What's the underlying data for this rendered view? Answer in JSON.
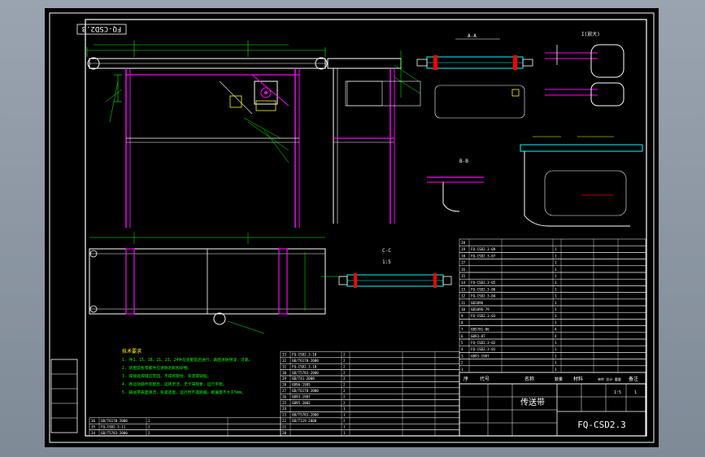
{
  "drawing": {
    "code": "FQ-CSD2.3",
    "code_stamp_top": "FQ-CSD2.3",
    "title": "传送带",
    "background": "#000000",
    "colors": {
      "frame": "#ffffff",
      "steel": "#ff00ff",
      "dimension": "#00ff00",
      "outline": "#ffffff",
      "yellow": "#ffff00",
      "cyan": "#00ffff",
      "red": "#ff0000"
    }
  },
  "section_labels": {
    "aa": "A-A",
    "bb": "B-B",
    "cc": "C-C",
    "scale": "1:5",
    "detail": "I(放大)"
  },
  "table_header": {
    "no": "序",
    "code": "代号",
    "name": "名称",
    "qty": "数量",
    "material": "材料",
    "weight": "单件 总计 重量",
    "note": "备注"
  },
  "bom_right": [
    {
      "no": "28",
      "code": "",
      "name": "",
      "qty": "",
      "mat": "",
      "note": ""
    },
    {
      "no": "19",
      "code": "FQ-CSD2.3-09",
      "name": "",
      "qty": "1",
      "mat": "",
      "note": ""
    },
    {
      "no": "18",
      "code": "FQ-CSD2.3-07",
      "name": "",
      "qty": "1",
      "mat": "",
      "note": ""
    },
    {
      "no": "17",
      "code": "",
      "name": "",
      "qty": "1",
      "mat": "",
      "note": ""
    },
    {
      "no": "16",
      "code": "",
      "name": "",
      "qty": "1",
      "mat": "",
      "note": ""
    },
    {
      "no": "15",
      "code": "",
      "name": "",
      "qty": "1",
      "mat": "",
      "note": ""
    },
    {
      "no": "14",
      "code": "FQ-CSD2.3-05",
      "name": "",
      "qty": "1",
      "mat": "",
      "note": ""
    },
    {
      "no": "13",
      "code": "FQ-CSD2.3-06",
      "name": "",
      "qty": "1",
      "mat": "",
      "note": ""
    },
    {
      "no": "12",
      "code": "FQ-CSD2.3-04",
      "name": "",
      "qty": "1",
      "mat": "",
      "note": ""
    },
    {
      "no": "11",
      "code": "GB1096",
      "name": "",
      "qty": "1",
      "mat": "",
      "note": ""
    },
    {
      "no": "10",
      "code": "GB1096-79",
      "name": "",
      "qty": "1",
      "mat": "",
      "note": ""
    },
    {
      "no": "9",
      "code": "FQ-CSD2.3-03",
      "name": "",
      "qty": "1",
      "mat": "",
      "note": ""
    },
    {
      "no": "8",
      "code": "",
      "name": "",
      "qty": "1",
      "mat": "",
      "note": ""
    },
    {
      "no": "7",
      "code": "GB5781-86",
      "name": "",
      "qty": "4",
      "mat": "",
      "note": ""
    },
    {
      "no": "6",
      "code": "GB93-87",
      "name": "",
      "qty": "4",
      "mat": "",
      "note": ""
    },
    {
      "no": "5",
      "code": "FQ-CSD2.3-02",
      "name": "",
      "qty": "1",
      "mat": "",
      "note": ""
    },
    {
      "no": "4",
      "code": "FQ-CSD2.3-01",
      "name": "",
      "qty": "1",
      "mat": "",
      "note": ""
    },
    {
      "no": "3",
      "code": "GB93-1987",
      "name": "",
      "qty": "1",
      "mat": "",
      "note": ""
    },
    {
      "no": "2",
      "code": "",
      "name": "",
      "qty": "1",
      "mat": "",
      "note": ""
    },
    {
      "no": "1",
      "code": "",
      "name": "",
      "qty": "1",
      "mat": "",
      "note": ""
    }
  ],
  "bom_mid": [
    {
      "no": "33",
      "code": "FQ-CSD2.3-10",
      "qty": "2"
    },
    {
      "no": "32",
      "code": "GB/T6170-2000",
      "qty": "2"
    },
    {
      "no": "31",
      "code": "FQ-CSD2.3-10",
      "qty": "2"
    },
    {
      "no": "30",
      "code": "GB/T5783-2000",
      "qty": "2"
    },
    {
      "no": "29",
      "code": "GB/T41-2000",
      "qty": "2"
    },
    {
      "no": "28",
      "code": "GB96-1985",
      "qty": "2"
    },
    {
      "no": "27",
      "code": "GB/T6170-2000",
      "qty": "2"
    },
    {
      "no": "26",
      "code": "GB93-1987",
      "qty": "2"
    },
    {
      "no": "25",
      "code": "GB95-2002",
      "qty": "2"
    },
    {
      "no": "24",
      "code": "",
      "qty": "1"
    },
    {
      "no": "23",
      "code": "GB/T5783-2000",
      "qty": "1"
    },
    {
      "no": "22",
      "code": "GB/T119-2000",
      "qty": "2"
    },
    {
      "no": "21",
      "code": "",
      "qty": "1"
    },
    {
      "no": "20",
      "code": "",
      "qty": "1"
    }
  ],
  "bom_left": [
    {
      "no": "36",
      "code": "GB/T6170-2000",
      "qty": "2"
    },
    {
      "no": "35",
      "code": "FQ-CSD2.3-11",
      "qty": "2"
    },
    {
      "no": "34",
      "code": "GB/T5783-2000",
      "qty": "2"
    }
  ],
  "notes_title": "技术要求",
  "notes": [
    "1. 件1、15、18、21、23、24件在装配前后进行，表面涂防锈漆，可靠。",
    "2. 装配前各零部件应清除毛刺和杂物。",
    "3. 焊接处焊缝应牢固，不得有裂纹、夹渣等缺陷。",
    "4. 各运动部件装配后，运转灵活，无卡滞现象，运行平稳。",
    "5. 输送带表面清洁，张紧适度，运行时不得跑偏，跑偏量不大于5mm。"
  ],
  "title_block": {
    "scale": "1:5",
    "sheet": "1"
  },
  "left_box": [
    "",
    "",
    "",
    "",
    ""
  ]
}
